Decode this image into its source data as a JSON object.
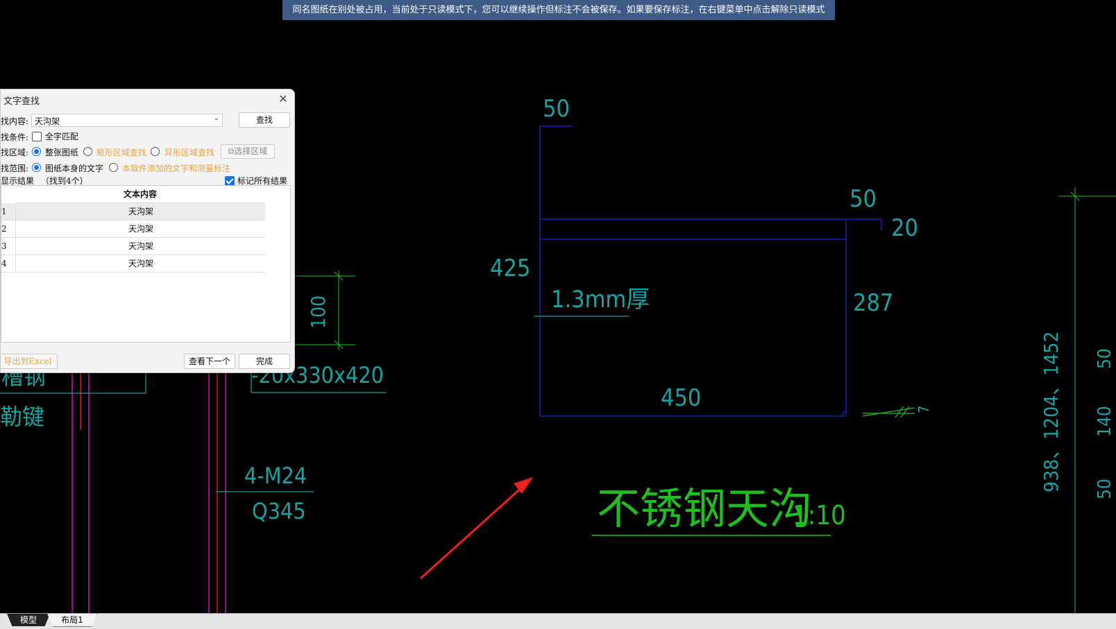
{
  "banner": {
    "text": "同名图纸在别处被占用，当前处于只读模式下，您可以继续操作但标注不会被保存。如果要保存标注，在右键菜单中点击解除只读模式"
  },
  "dialog": {
    "title": "文字查找",
    "search_content_label": "找内容:",
    "search_content_value": "天沟架",
    "find_button": "查找",
    "condition_label": "找条件:",
    "whole_word_label": "全字匹配",
    "area_label": "找区域:",
    "area_options": [
      "整张图纸",
      "矩形区域查找",
      "异形区域查找"
    ],
    "select_area_button": "选择区域",
    "scope_label": "找范围:",
    "scope_options": [
      "图纸本身的文字",
      "本软件添加的文字和测量标注"
    ],
    "results_label": "显示结果",
    "results_count": "（找到4个）",
    "mark_all_label": "标记所有结果",
    "table_header": "文本内容",
    "rows": [
      {
        "idx": "1",
        "text": "天沟架"
      },
      {
        "idx": "2",
        "text": "天沟架"
      },
      {
        "idx": "3",
        "text": "天沟架"
      },
      {
        "idx": "4",
        "text": "天沟架"
      }
    ],
    "export_button": "导出到Excel",
    "next_button": "查看下一个",
    "done_button": "完成"
  },
  "drawing": {
    "labels": {
      "dim_50_top": "50",
      "dim_50_right": "50",
      "dim_20": "20",
      "dim_425": "425",
      "thickness": "1.3mm厚",
      "dim_287": "287",
      "dim_450": "450",
      "dim_100": "100",
      "plate_spec": "-20x330x420",
      "bolt_spec": "4-M24",
      "grade": "Q345",
      "title": "不锈钢天沟",
      "scale": "1:10",
      "left_text_1": "槽钢",
      "left_text_2": "勒键",
      "right_vertical": "938、1204、1452",
      "right_dims": [
        "50",
        "140",
        "50"
      ],
      "weld_mark": "7"
    },
    "colors": {
      "blue_line": "#1c26c8",
      "cyan_text": "#1aa3a3",
      "green_text": "#1fbf1f",
      "green_line": "#1fbf1f",
      "magenta": "#c21ec2",
      "red": "#e01818",
      "arrow": "#ee2222"
    }
  },
  "tabs": {
    "model": "模型",
    "layout": "布局1"
  }
}
